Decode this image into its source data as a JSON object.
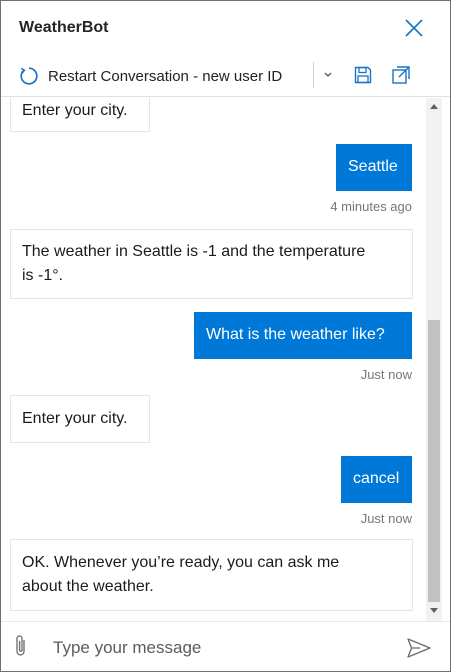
{
  "header": {
    "title": "WeatherBot"
  },
  "toolbar": {
    "restart_label": "Restart Conversation - new user ID"
  },
  "icons": {
    "close": "close-icon",
    "restart": "refresh-icon",
    "dropdown": "chevron-down-icon",
    "save": "save-icon",
    "popout": "popout-icon",
    "attach": "paperclip-icon",
    "send": "send-icon"
  },
  "colors": {
    "accent": "#0078d7",
    "user_text": "#ffffff",
    "bot_border": "#e5e5e5",
    "timestamp": "#767676"
  },
  "transcript": {
    "messages": [
      {
        "from": "bot",
        "text": "Enter your city."
      },
      {
        "from": "user",
        "text": "Seattle",
        "timestamp": "4 minutes ago"
      },
      {
        "from": "bot",
        "text_line1": "The weather in Seattle is -1 and the temperature",
        "text_line2": "is -1°."
      },
      {
        "from": "user",
        "text": "What is the weather like?",
        "timestamp": "Just now"
      },
      {
        "from": "bot",
        "text": "Enter your city."
      },
      {
        "from": "user",
        "text": "cancel",
        "timestamp": "Just now"
      },
      {
        "from": "bot",
        "text_line1": "OK. Whenever you’re ready, you can ask me",
        "text_line2": "about the weather."
      }
    ]
  },
  "sendbox": {
    "placeholder": "Type your message"
  }
}
